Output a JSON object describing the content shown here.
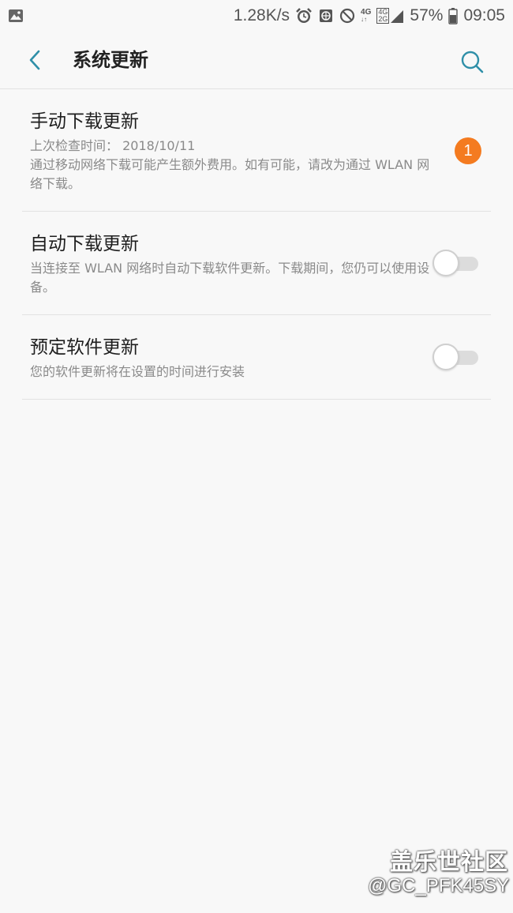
{
  "status_bar": {
    "speed": "1.28K/s",
    "network_4g": "4G",
    "network_4g2g_top": "4G",
    "network_4g2g_bottom": "2G",
    "battery": "57%",
    "time": "09:05",
    "icons": [
      "gallery-icon",
      "alarm-icon",
      "vpn-icon",
      "block-icon",
      "signal-icon",
      "battery-icon"
    ]
  },
  "header": {
    "title": "系统更新",
    "accent_color": "#2f8fa8"
  },
  "settings": {
    "manual": {
      "title": "手动下载更新",
      "last_check": "上次检查时间： 2018/10/11",
      "description": "通过移动网络下载可能产生额外费用。如有可能，请改为通过 WLAN 网络下载。",
      "badge": "1",
      "badge_color": "#f47b20"
    },
    "auto": {
      "title": "自动下载更新",
      "description": "当连接至 WLAN 网络时自动下载软件更新。下载期间，您仍可以使用设备。",
      "enabled": false
    },
    "scheduled": {
      "title": "预定软件更新",
      "description": "您的软件更新将在设置的时间进行安装",
      "enabled": false
    }
  },
  "watermark": {
    "title": "盖乐世社区",
    "user": "@GC_PFK45SY"
  }
}
